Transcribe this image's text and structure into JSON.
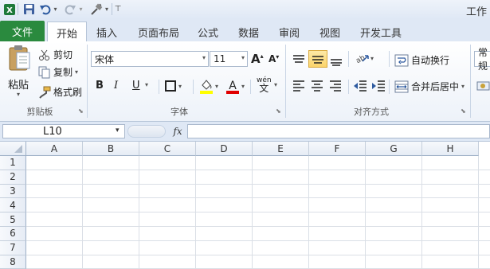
{
  "title": "工作",
  "qat": {
    "icons": [
      "excel-logo-icon",
      "save-icon",
      "undo-icon",
      "redo-icon",
      "format-painter-qat-icon",
      "customize-qat-icon"
    ]
  },
  "tabs": [
    {
      "label": "文件",
      "key": "file"
    },
    {
      "label": "开始",
      "key": "home"
    },
    {
      "label": "插入",
      "key": "insert"
    },
    {
      "label": "页面布局",
      "key": "page-layout"
    },
    {
      "label": "公式",
      "key": "formulas"
    },
    {
      "label": "数据",
      "key": "data"
    },
    {
      "label": "审阅",
      "key": "review"
    },
    {
      "label": "视图",
      "key": "view"
    },
    {
      "label": "开发工具",
      "key": "developer"
    }
  ],
  "clipboard": {
    "paste": "粘贴",
    "cut": "剪切",
    "copy": "复制",
    "format_painter": "格式刷",
    "group": "剪贴板"
  },
  "font": {
    "name": "宋体",
    "size": "11",
    "bold": "B",
    "italic": "I",
    "underline": "U",
    "group": "字体",
    "grow": "A",
    "shrink": "A",
    "wen": "wén",
    "font_color_letter": "A"
  },
  "alignment": {
    "wrap": "自动换行",
    "merge": "合并后居中",
    "group": "对齐方式"
  },
  "number": {
    "format": "常规"
  },
  "formula_bar": {
    "name_box": "L10",
    "fx": "fx",
    "formula": ""
  },
  "columns": [
    "A",
    "B",
    "C",
    "D",
    "E",
    "F",
    "G",
    "H"
  ],
  "rows": [
    "1",
    "2",
    "3",
    "4",
    "5",
    "6",
    "7",
    "8"
  ],
  "colors": {
    "file_tab": "#2a8a3e",
    "fill_color": "#ffff00",
    "font_color": "#e00000"
  }
}
